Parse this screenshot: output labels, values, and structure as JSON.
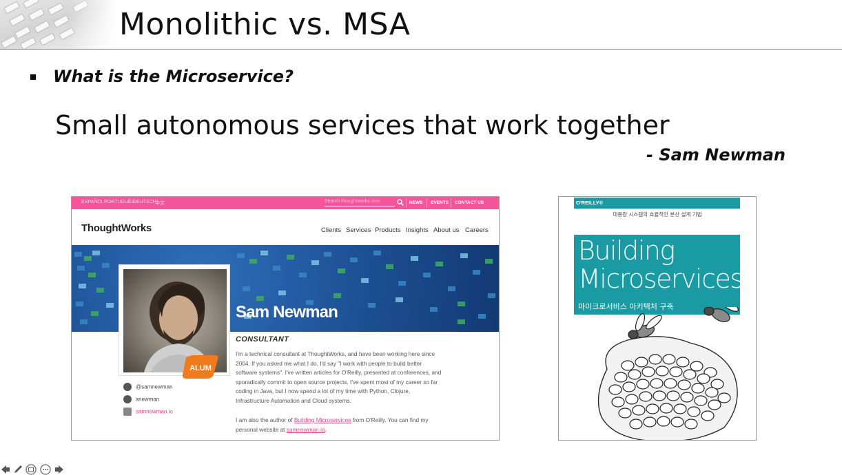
{
  "slide": {
    "title": "Monolithic vs. MSA",
    "question": "What is the Microservice?",
    "quote": "Small autonomous services that work together",
    "attribution": "- Sam Newman"
  },
  "thoughtworks": {
    "languages": [
      "ESPAÑOL",
      "PORTUGUÊS",
      "DEUTSCH",
      "中文"
    ],
    "search_placeholder": "Search thoughtworks.com",
    "top_links": [
      "NEWS",
      "EVENTS",
      "CONTACT US"
    ],
    "logo": "ThoughtWorks",
    "nav": [
      "Clients",
      "Services",
      "Products",
      "Insights",
      "About us",
      "Careers"
    ],
    "name": "Sam Newman",
    "badge": "ALUM",
    "role": "CONSULTANT",
    "bio": "I'm a technical consultant at ThoughtWorks, and have been working here since 2004.  If you asked me what I do, I'd say \"I work with people to build better software systems\". I've written articles for O'Reilly, presented at conferences, and sporadically commit to open source projects. I've spent most of my career so far coding in Java, but I now spend a lot of my time with Python, Clojure, Infrastructure Automation and Cloud systems.",
    "bio2_prefix": "I am also the author of ",
    "bio2_book": "Building Microservices",
    "bio2_mid": " from O'Reilly. You can find my personal website at ",
    "bio2_site": "samnewman.io",
    "bio2_suffix": ".",
    "social": [
      {
        "icon": "twitter-icon",
        "text": "@samnewman"
      },
      {
        "icon": "github-icon",
        "text": "snewman"
      },
      {
        "icon": "rss-icon",
        "text": "samnewman.io"
      }
    ],
    "colors": {
      "brand": "#f5559a",
      "banner": "#1d4f94"
    }
  },
  "book": {
    "publisher": "O'REILLY®",
    "subtitle": "대용량 시스템의 효율적인 분산 설계 기법",
    "title_line1": "Building",
    "title_line2": "Microservices",
    "korean_title": "마이크로서비스 아키텍처 구축",
    "color": "#1a9aa3"
  },
  "toolbar": {
    "icons": [
      "previous-icon",
      "pen-icon",
      "slides-icon",
      "more-icon",
      "next-icon"
    ]
  }
}
